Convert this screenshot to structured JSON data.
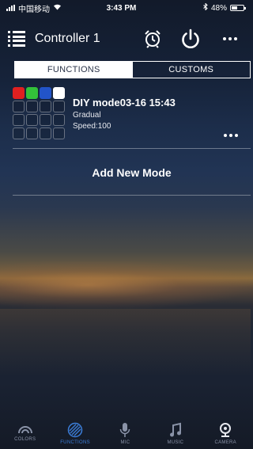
{
  "status_bar": {
    "carrier": "中国移动",
    "time": "3:43 PM",
    "battery_text": "48%",
    "battery_level": 0.48
  },
  "header": {
    "title": "Controller 1",
    "icons": [
      "menu-icon",
      "alarm-clock-icon",
      "power-icon",
      "more-icon"
    ]
  },
  "tabs": [
    {
      "label": "FUNCTIONS",
      "active": false
    },
    {
      "label": "CUSTOMS",
      "active": true
    }
  ],
  "modes": [
    {
      "name": "DIY mode03-16 15:43",
      "effect": "Gradual",
      "speed": "Speed:100",
      "swatches": [
        "#e02020",
        "#33c23a",
        "#2254c8",
        "#ffffff"
      ]
    }
  ],
  "add_mode_label": "Add New Mode",
  "bottom_nav": [
    {
      "label": "COLORS",
      "icon": "color-wheel-icon",
      "active": false
    },
    {
      "label": "FUNCTIONS",
      "icon": "functions-icon",
      "active": true
    },
    {
      "label": "MIC",
      "icon": "microphone-icon",
      "active": false
    },
    {
      "label": "MUSIC",
      "icon": "music-note-icon",
      "active": false
    },
    {
      "label": "CAMERA",
      "icon": "camera-icon",
      "active": false
    }
  ],
  "colors": {
    "accent": "#3b7dd8",
    "inactive_nav": "#8a93a8"
  }
}
